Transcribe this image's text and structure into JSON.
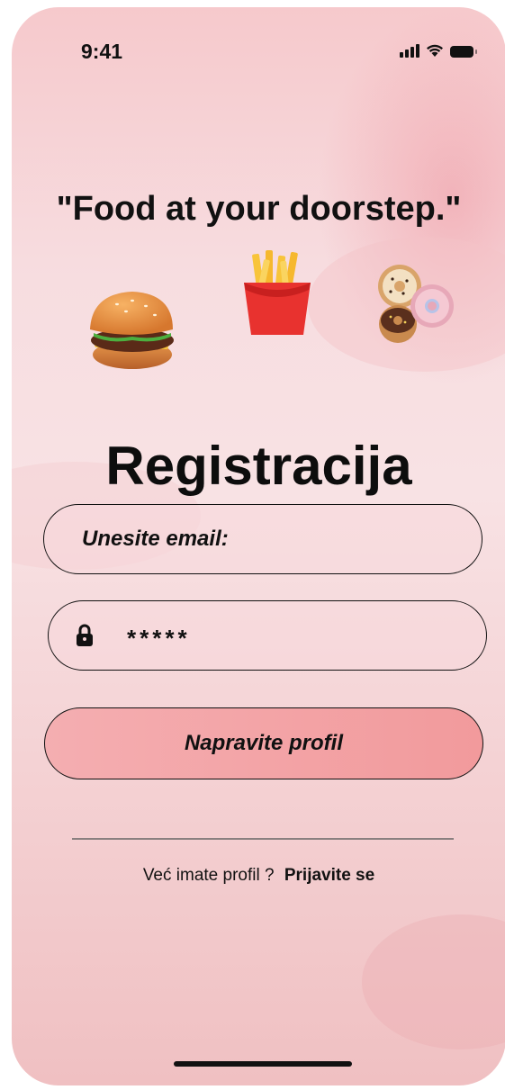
{
  "status_bar": {
    "time": "9:41",
    "icons": [
      "cellular-signal-icon",
      "wifi-icon",
      "battery-icon"
    ]
  },
  "tagline": "\"Food at your doorstep.\"",
  "illustrations": [
    "burger-icon",
    "fries-icon",
    "donuts-icon"
  ],
  "title": "Registracija",
  "form": {
    "email_placeholder": "Unesite email:",
    "password_value": "*****",
    "password_icon": "lock-icon",
    "submit_label": "Napravite profil"
  },
  "footer": {
    "question": "Već imate profil ?",
    "login_link": "Prijavite se"
  },
  "colors": {
    "background_top": "#f6c9cc",
    "background_bottom": "#f0c0c2",
    "button_fill": "#f29a9c",
    "text": "#111111"
  }
}
